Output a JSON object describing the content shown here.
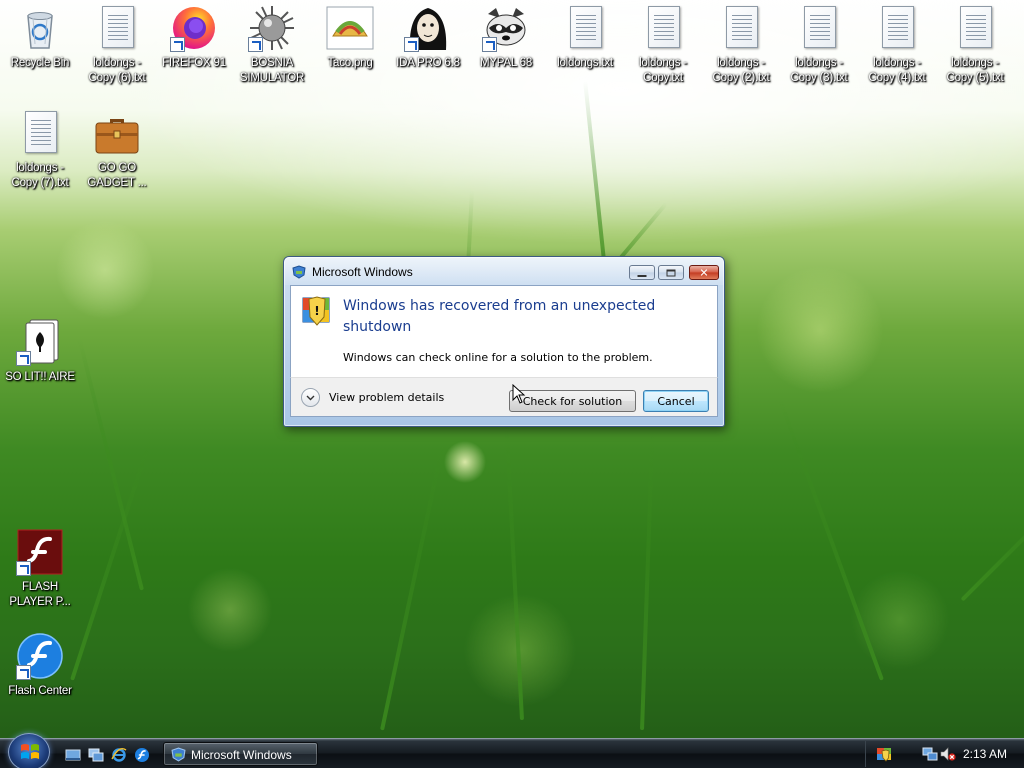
{
  "desktop": {
    "icons": [
      {
        "label": "Recycle Bin",
        "icon": "recycle-bin-icon",
        "shortcut": false
      },
      {
        "label": "loldongs -\nCopy (6).txt",
        "icon": "text-file-icon",
        "shortcut": false
      },
      {
        "label": "FIREFOX 91",
        "icon": "firefox-icon",
        "shortcut": true
      },
      {
        "label": "BOSNIA\nSIMULATOR",
        "icon": "spiky-mine-icon",
        "shortcut": true
      },
      {
        "label": "Taco.png",
        "icon": "taco-image-icon",
        "shortcut": false
      },
      {
        "label": "IDA PRO 6.8",
        "icon": "ida-pro-icon",
        "shortcut": true
      },
      {
        "label": "MYPAL 68",
        "icon": "mypal-raccoon-icon",
        "shortcut": true
      },
      {
        "label": "loldongs.txt",
        "icon": "text-file-icon",
        "shortcut": false
      },
      {
        "label": "loldongs -\nCopy.txt",
        "icon": "text-file-icon",
        "shortcut": false
      },
      {
        "label": "loldongs -\nCopy (2).txt",
        "icon": "text-file-icon",
        "shortcut": false
      },
      {
        "label": "loldongs -\nCopy (3).txt",
        "icon": "text-file-icon",
        "shortcut": false
      },
      {
        "label": "loldongs -\nCopy (4).txt",
        "icon": "text-file-icon",
        "shortcut": false
      },
      {
        "label": "loldongs -\nCopy (5).txt",
        "icon": "text-file-icon",
        "shortcut": false
      },
      {
        "label": "loldongs -\nCopy (7).txt",
        "icon": "text-file-icon",
        "shortcut": false
      },
      {
        "label": "GO GO\nGADGET ...",
        "icon": "briefcase-icon",
        "shortcut": false
      },
      {
        "label": "SO LIT!! AIRE",
        "icon": "solitaire-card-icon",
        "shortcut": true
      },
      {
        "label": "FLASH\nPLAYER P...",
        "icon": "flash-player-icon",
        "shortcut": true
      },
      {
        "label": "Flash Center",
        "icon": "flash-center-icon",
        "shortcut": true
      }
    ]
  },
  "dialog": {
    "title": "Microsoft Windows",
    "main_instruction": "Windows has recovered from an unexpected shutdown",
    "content": "Windows can check online for a solution to the problem.",
    "details_label": "View problem details",
    "check_button": "Check for solution",
    "cancel_button": "Cancel",
    "icon": "security-shield-icon"
  },
  "taskbar": {
    "task_button_label": "Microsoft Windows",
    "clock": "2:13 AM",
    "quick_launch": [
      "show-desktop-icon",
      "switch-windows-icon",
      "internet-explorer-icon",
      "flash-icon"
    ],
    "tray_icons": [
      "security-center-icon",
      "network-icon",
      "volume-muted-icon"
    ]
  },
  "colors": {
    "dialog_instruction": "#1a3d8f",
    "taskbar": "#151b21",
    "close_button": "#c23a21"
  }
}
